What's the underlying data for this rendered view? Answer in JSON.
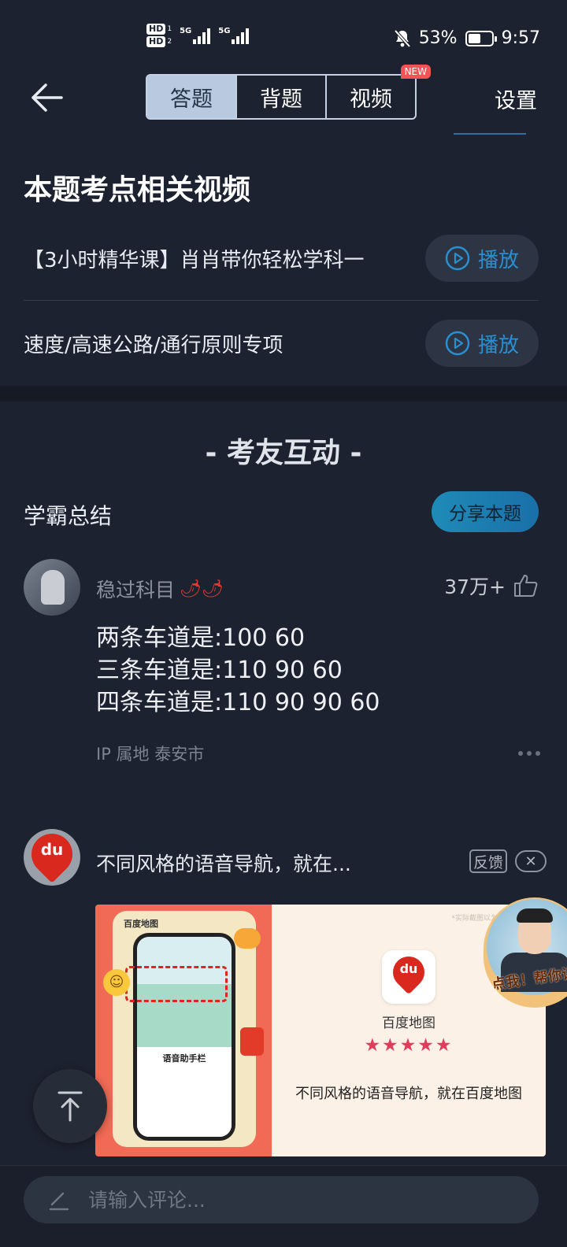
{
  "status_bar": {
    "hd1": "HD",
    "hd1_sub": "1",
    "hd2": "HD",
    "hd2_sub": "2",
    "net1": "5G",
    "net2": "5G",
    "battery_text": "53%",
    "battery_level": 0.53,
    "time": "9:57"
  },
  "header": {
    "tabs": [
      {
        "label": "答题",
        "active": true
      },
      {
        "label": "背题",
        "active": false
      },
      {
        "label": "视频",
        "active": false
      }
    ],
    "new_badge": "NEW",
    "settings_label": "设置"
  },
  "related_videos": {
    "title": "本题考点相关视频",
    "items": [
      {
        "title": "【3小时精华课】肖肖带你轻松学科一",
        "play_label": "播放"
      },
      {
        "title": "速度/高速公路/通行原则专项",
        "play_label": "播放"
      }
    ]
  },
  "interaction": {
    "title": "- 考友互动 -",
    "summary_label": "学霸总结",
    "share_label": "分享本题"
  },
  "comment": {
    "username": "稳过科目",
    "chili": "🌶🌶",
    "likes": "37万+",
    "lines": [
      "两条车道是:100  60",
      "三条车道是:110  90  60",
      "四条车道是:110  90  90  60"
    ],
    "ip_location": "IP 属地 泰安市"
  },
  "ad": {
    "avatar_text": "du",
    "title": "不同风格的语音导航，就在...",
    "feedback_label": "反馈",
    "close_label": "✕",
    "left_brand": "百度地图",
    "left_voice": "语音助手栏",
    "tiny_note": "*实际截图以为准",
    "app_icon_text": "du",
    "app_name": "百度地图",
    "stars": "★★★★★",
    "rating": 4.5,
    "description": "不同风格的语音导航，就在百度地图",
    "host_cta": "点我！帮你讲"
  },
  "bottom": {
    "comment_placeholder": "请输入评论..."
  },
  "colors": {
    "background": "#1d2230",
    "play_accent": "#2a8fd0",
    "share_gradient_start": "#1f8bb8",
    "tab_active": "#b8c9e0",
    "badge_red": "#f05454"
  }
}
